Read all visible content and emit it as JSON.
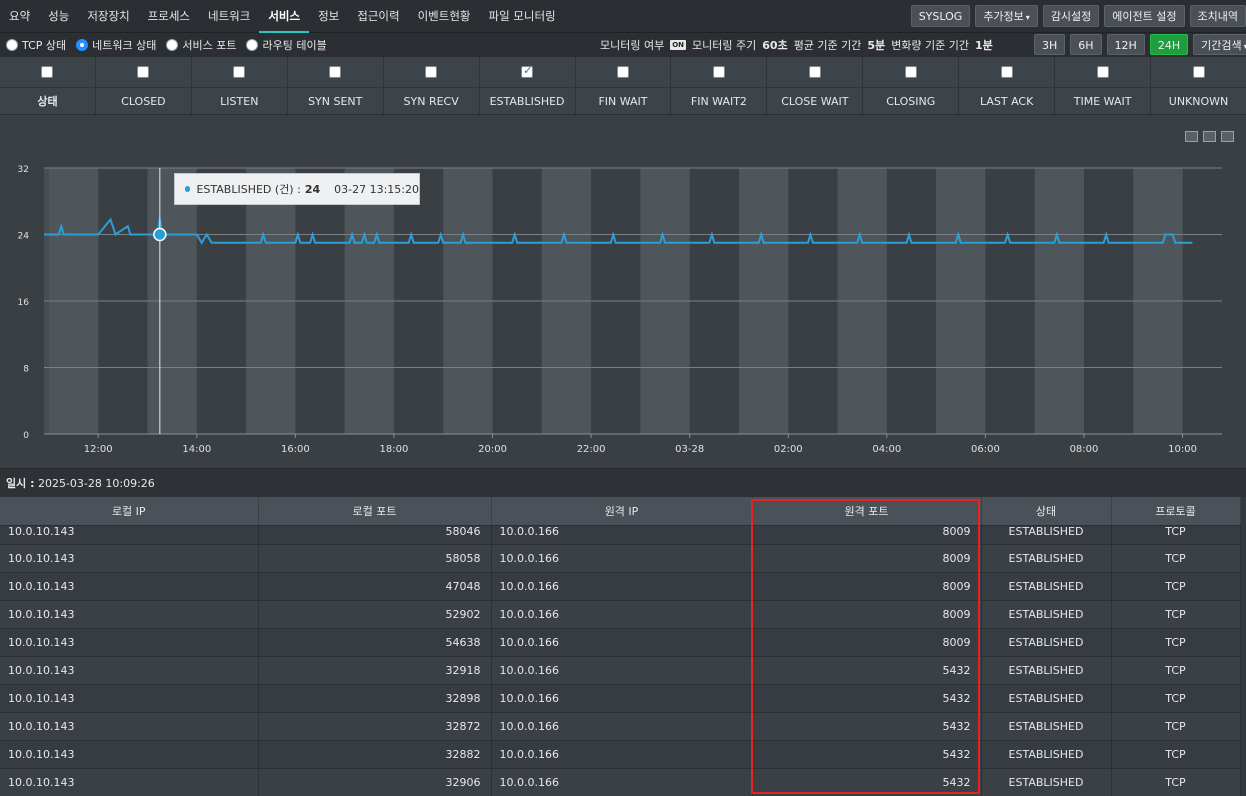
{
  "tabs": [
    "요약",
    "성능",
    "저장장치",
    "프로세스",
    "네트워크",
    "서비스",
    "정보",
    "접근이력",
    "이벤트현황",
    "파일 모니터링"
  ],
  "active_tab": "서비스",
  "top_buttons": {
    "syslog": "SYSLOG",
    "extra": "추가정보",
    "watch": "감시설정",
    "agent": "에이전트 설정",
    "action": "조치내역"
  },
  "radios": [
    {
      "label": "TCP 상태",
      "checked": false
    },
    {
      "label": "네트워크 상태",
      "checked": true
    },
    {
      "label": "서비스 포트",
      "checked": false
    },
    {
      "label": "라우팅 테이블",
      "checked": false
    }
  ],
  "monitor": {
    "enabled_label": "모니터링 여부",
    "enabled_badge": "ON",
    "cycle_label": "모니터링 주기",
    "cycle_value": "60초",
    "avg_label": "평균 기준 기간",
    "avg_value": "5분",
    "delta_label": "변화량 기준 기간",
    "delta_value": "1분"
  },
  "ranges": [
    {
      "label": "3H",
      "active": false
    },
    {
      "label": "6H",
      "active": false
    },
    {
      "label": "12H",
      "active": false
    },
    {
      "label": "24H",
      "active": true
    }
  ],
  "period_search": "기간검색",
  "states": [
    {
      "label": "상태",
      "checked": false
    },
    {
      "label": "CLOSED",
      "checked": false
    },
    {
      "label": "LISTEN",
      "checked": false
    },
    {
      "label": "SYN SENT",
      "checked": false
    },
    {
      "label": "SYN RECV",
      "checked": false
    },
    {
      "label": "ESTABLISHED",
      "checked": true
    },
    {
      "label": "FIN WAIT",
      "checked": false
    },
    {
      "label": "FIN WAIT2",
      "checked": false
    },
    {
      "label": "CLOSE WAIT",
      "checked": false
    },
    {
      "label": "CLOSING",
      "checked": false
    },
    {
      "label": "LAST ACK",
      "checked": false
    },
    {
      "label": "TIME WAIT",
      "checked": false
    },
    {
      "label": "UNKNOWN",
      "checked": false
    }
  ],
  "tooltip": {
    "series": "ESTABLISHED (건) :",
    "value": "24",
    "time": "03-27 13:15:20"
  },
  "chart_data": {
    "type": "line",
    "x_ticks": [
      "12:00",
      "14:00",
      "16:00",
      "18:00",
      "20:00",
      "22:00",
      "03-28",
      "02:00",
      "04:00",
      "06:00",
      "08:00",
      "10:00"
    ],
    "y_ticks": [
      0,
      8,
      16,
      24,
      32
    ],
    "ylim": [
      0,
      32
    ],
    "x_range_hours": [
      10.9,
      34.8
    ],
    "series": [
      {
        "name": "ESTABLISHED (건)",
        "color": "#2a9fd6",
        "points": [
          [
            10.9,
            24
          ],
          [
            11.2,
            24
          ],
          [
            11.25,
            25
          ],
          [
            11.3,
            24
          ],
          [
            12.0,
            24
          ],
          [
            12.25,
            25.8
          ],
          [
            12.35,
            24
          ],
          [
            12.6,
            25
          ],
          [
            12.65,
            24
          ],
          [
            13.2,
            24
          ],
          [
            13.25,
            26
          ],
          [
            13.3,
            24
          ],
          [
            14.0,
            24
          ],
          [
            14.1,
            23
          ],
          [
            14.2,
            24
          ],
          [
            14.3,
            23
          ],
          [
            15.3,
            23
          ],
          [
            15.35,
            24
          ],
          [
            15.4,
            23
          ],
          [
            16.0,
            23
          ],
          [
            16.05,
            24
          ],
          [
            16.1,
            23
          ],
          [
            16.3,
            23
          ],
          [
            16.35,
            24
          ],
          [
            16.4,
            23
          ],
          [
            17.1,
            23
          ],
          [
            17.15,
            24
          ],
          [
            17.2,
            23
          ],
          [
            17.35,
            23
          ],
          [
            17.4,
            24
          ],
          [
            17.45,
            23
          ],
          [
            17.6,
            23
          ],
          [
            17.65,
            24
          ],
          [
            17.7,
            23
          ],
          [
            18.3,
            23
          ],
          [
            18.35,
            24
          ],
          [
            18.4,
            23
          ],
          [
            18.9,
            23
          ],
          [
            18.95,
            24
          ],
          [
            19.0,
            23
          ],
          [
            19.35,
            23
          ],
          [
            19.4,
            24
          ],
          [
            19.45,
            23
          ],
          [
            20.4,
            23
          ],
          [
            20.45,
            24
          ],
          [
            20.5,
            23
          ],
          [
            21.4,
            23
          ],
          [
            21.45,
            24
          ],
          [
            21.5,
            23
          ],
          [
            22.4,
            23
          ],
          [
            22.45,
            24
          ],
          [
            22.5,
            23
          ],
          [
            23.4,
            23
          ],
          [
            23.45,
            24
          ],
          [
            23.5,
            23
          ],
          [
            24.4,
            23
          ],
          [
            24.45,
            24
          ],
          [
            24.5,
            23
          ],
          [
            25.4,
            23
          ],
          [
            25.45,
            24
          ],
          [
            25.5,
            23
          ],
          [
            26.4,
            23
          ],
          [
            26.45,
            24
          ],
          [
            26.5,
            23
          ],
          [
            27.4,
            23
          ],
          [
            27.45,
            24
          ],
          [
            27.5,
            23
          ],
          [
            28.4,
            23
          ],
          [
            28.45,
            24
          ],
          [
            28.5,
            23
          ],
          [
            29.4,
            23
          ],
          [
            29.45,
            24
          ],
          [
            29.5,
            23
          ],
          [
            30.4,
            23
          ],
          [
            30.45,
            24
          ],
          [
            30.5,
            23
          ],
          [
            31.4,
            23
          ],
          [
            31.45,
            24
          ],
          [
            31.5,
            23
          ],
          [
            32.4,
            23
          ],
          [
            32.45,
            24
          ],
          [
            32.5,
            23
          ],
          [
            33.6,
            23
          ],
          [
            33.65,
            24
          ],
          [
            33.8,
            24
          ],
          [
            33.85,
            23
          ],
          [
            34.2,
            23
          ]
        ]
      }
    ],
    "hover": {
      "x": 13.25,
      "y": 24
    }
  },
  "timestamp_label": "일시 :",
  "timestamp_value": "2025-03-28 10:09:26",
  "table": {
    "columns": [
      "로컬 IP",
      "로컬 포트",
      "원격 IP",
      "원격 포트",
      "상태",
      "프로토콜"
    ],
    "rows": [
      [
        "10.0.10.143",
        "58046",
        "10.0.0.166",
        "8009",
        "ESTABLISHED",
        "TCP"
      ],
      [
        "10.0.10.143",
        "58058",
        "10.0.0.166",
        "8009",
        "ESTABLISHED",
        "TCP"
      ],
      [
        "10.0.10.143",
        "47048",
        "10.0.0.166",
        "8009",
        "ESTABLISHED",
        "TCP"
      ],
      [
        "10.0.10.143",
        "52902",
        "10.0.0.166",
        "8009",
        "ESTABLISHED",
        "TCP"
      ],
      [
        "10.0.10.143",
        "54638",
        "10.0.0.166",
        "8009",
        "ESTABLISHED",
        "TCP"
      ],
      [
        "10.0.10.143",
        "32918",
        "10.0.0.166",
        "5432",
        "ESTABLISHED",
        "TCP"
      ],
      [
        "10.0.10.143",
        "32898",
        "10.0.0.166",
        "5432",
        "ESTABLISHED",
        "TCP"
      ],
      [
        "10.0.10.143",
        "32872",
        "10.0.0.166",
        "5432",
        "ESTABLISHED",
        "TCP"
      ],
      [
        "10.0.10.143",
        "32882",
        "10.0.0.166",
        "5432",
        "ESTABLISHED",
        "TCP"
      ],
      [
        "10.0.10.143",
        "32906",
        "10.0.0.166",
        "5432",
        "ESTABLISHED",
        "TCP"
      ]
    ]
  }
}
